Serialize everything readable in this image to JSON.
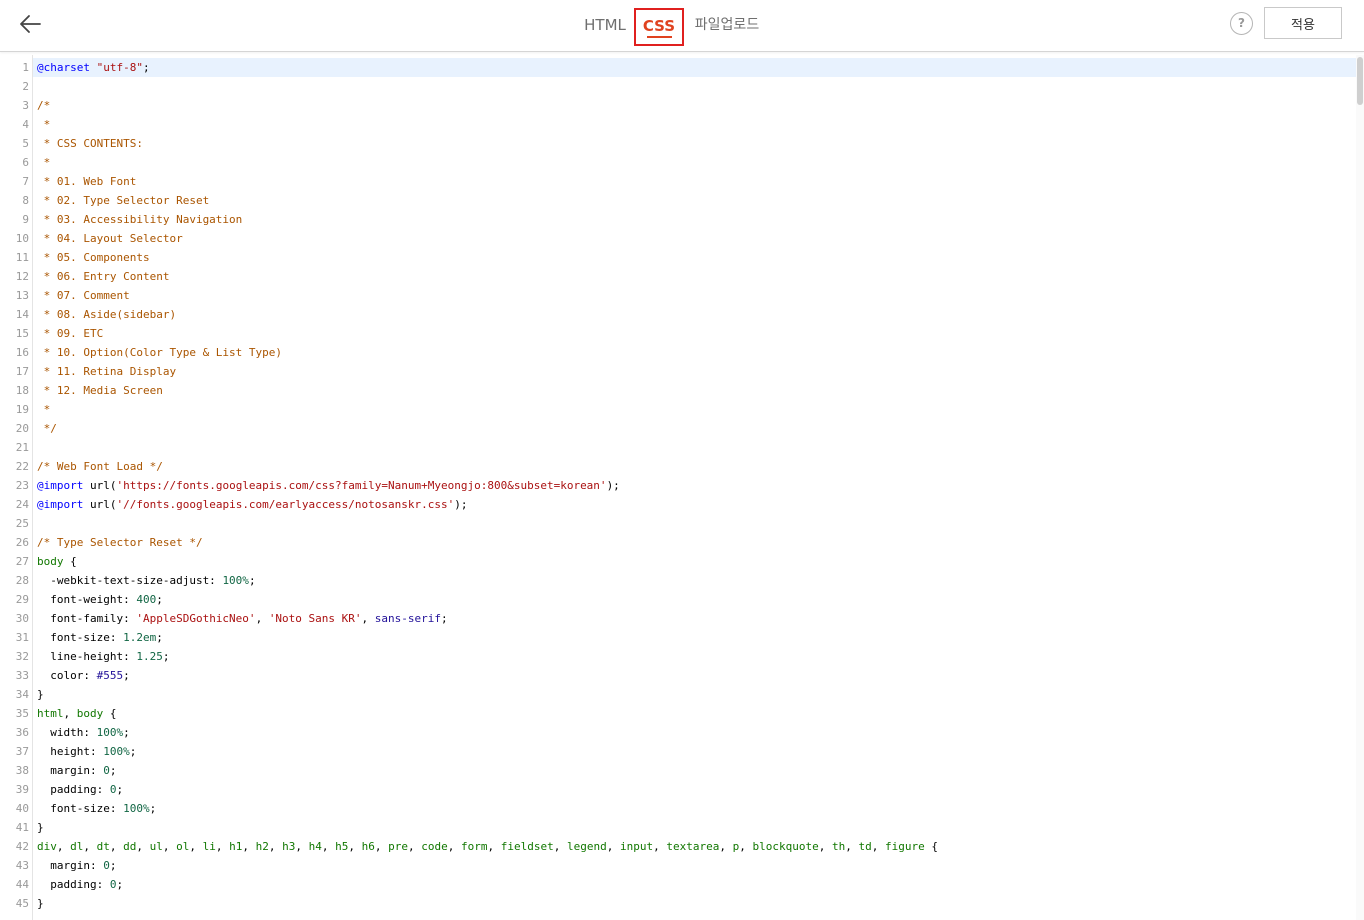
{
  "header": {
    "back_label": "back",
    "tabs": [
      {
        "label": "HTML",
        "active": false
      },
      {
        "label": "CSS",
        "active": true
      },
      {
        "label": "파일업로드",
        "active": false
      }
    ],
    "help_label": "?",
    "apply_label": "적용"
  },
  "editor": {
    "lines": [
      {
        "n": "1",
        "t": [
          [
            "c-def",
            "@charset"
          ],
          [
            "c-plain",
            " "
          ],
          [
            "c-string",
            "\"utf-8\""
          ],
          [
            "c-plain",
            ";"
          ]
        ]
      },
      {
        "n": "2",
        "t": []
      },
      {
        "n": "3",
        "t": [
          [
            "c-comment",
            "/*"
          ]
        ]
      },
      {
        "n": "4",
        "t": [
          [
            "c-comment",
            " *"
          ]
        ]
      },
      {
        "n": "5",
        "t": [
          [
            "c-comment",
            " * CSS CONTENTS:"
          ]
        ]
      },
      {
        "n": "6",
        "t": [
          [
            "c-comment",
            " *"
          ]
        ]
      },
      {
        "n": "7",
        "t": [
          [
            "c-comment",
            " * 01. Web Font"
          ]
        ]
      },
      {
        "n": "8",
        "t": [
          [
            "c-comment",
            " * 02. Type Selector Reset"
          ]
        ]
      },
      {
        "n": "9",
        "t": [
          [
            "c-comment",
            " * 03. Accessibility Navigation"
          ]
        ]
      },
      {
        "n": "10",
        "t": [
          [
            "c-comment",
            " * 04. Layout Selector"
          ]
        ]
      },
      {
        "n": "11",
        "t": [
          [
            "c-comment",
            " * 05. Components"
          ]
        ]
      },
      {
        "n": "12",
        "t": [
          [
            "c-comment",
            " * 06. Entry Content"
          ]
        ]
      },
      {
        "n": "13",
        "t": [
          [
            "c-comment",
            " * 07. Comment"
          ]
        ]
      },
      {
        "n": "14",
        "t": [
          [
            "c-comment",
            " * 08. Aside(sidebar)"
          ]
        ]
      },
      {
        "n": "15",
        "t": [
          [
            "c-comment",
            " * 09. ETC"
          ]
        ]
      },
      {
        "n": "16",
        "t": [
          [
            "c-comment",
            " * 10. Option(Color Type & List Type)"
          ]
        ]
      },
      {
        "n": "17",
        "t": [
          [
            "c-comment",
            " * 11. Retina Display"
          ]
        ]
      },
      {
        "n": "18",
        "t": [
          [
            "c-comment",
            " * 12. Media Screen"
          ]
        ]
      },
      {
        "n": "19",
        "t": [
          [
            "c-comment",
            " *"
          ]
        ]
      },
      {
        "n": "20",
        "t": [
          [
            "c-comment",
            " */"
          ]
        ]
      },
      {
        "n": "21",
        "t": []
      },
      {
        "n": "22",
        "t": [
          [
            "c-comment",
            "/* Web Font Load */"
          ]
        ]
      },
      {
        "n": "23",
        "t": [
          [
            "c-def",
            "@import"
          ],
          [
            "c-plain",
            " url("
          ],
          [
            "c-string",
            "'https://fonts.googleapis.com/css?family=Nanum+Myeongjo:800&subset=korean'"
          ],
          [
            "c-plain",
            ");"
          ]
        ]
      },
      {
        "n": "24",
        "t": [
          [
            "c-def",
            "@import"
          ],
          [
            "c-plain",
            " url("
          ],
          [
            "c-string",
            "'//fonts.googleapis.com/earlyaccess/notosanskr.css'"
          ],
          [
            "c-plain",
            ");"
          ]
        ]
      },
      {
        "n": "25",
        "t": []
      },
      {
        "n": "26",
        "t": [
          [
            "c-comment",
            "/* Type Selector Reset */"
          ]
        ]
      },
      {
        "n": "27",
        "t": [
          [
            "c-tag",
            "body"
          ],
          [
            "c-plain",
            " {"
          ]
        ]
      },
      {
        "n": "28",
        "t": [
          [
            "c-plain",
            "  -webkit-text-size-adjust: "
          ],
          [
            "c-num",
            "100%"
          ],
          [
            "c-plain",
            ";"
          ]
        ]
      },
      {
        "n": "29",
        "t": [
          [
            "c-plain",
            "  font-weight: "
          ],
          [
            "c-num",
            "400"
          ],
          [
            "c-plain",
            ";"
          ]
        ]
      },
      {
        "n": "30",
        "t": [
          [
            "c-plain",
            "  font-family: "
          ],
          [
            "c-string",
            "'AppleSDGothicNeo'"
          ],
          [
            "c-plain",
            ", "
          ],
          [
            "c-string",
            "'Noto Sans KR'"
          ],
          [
            "c-plain",
            ", "
          ],
          [
            "c-atom",
            "sans-serif"
          ],
          [
            "c-plain",
            ";"
          ]
        ]
      },
      {
        "n": "31",
        "t": [
          [
            "c-plain",
            "  font-size: "
          ],
          [
            "c-num",
            "1.2em"
          ],
          [
            "c-plain",
            ";"
          ]
        ]
      },
      {
        "n": "32",
        "t": [
          [
            "c-plain",
            "  line-height: "
          ],
          [
            "c-num",
            "1.25"
          ],
          [
            "c-plain",
            ";"
          ]
        ]
      },
      {
        "n": "33",
        "t": [
          [
            "c-plain",
            "  color: "
          ],
          [
            "c-atom",
            "#555"
          ],
          [
            "c-plain",
            ";"
          ]
        ]
      },
      {
        "n": "34",
        "t": [
          [
            "c-plain",
            "}"
          ]
        ]
      },
      {
        "n": "35",
        "t": [
          [
            "c-tag",
            "html"
          ],
          [
            "c-plain",
            ", "
          ],
          [
            "c-tag",
            "body"
          ],
          [
            "c-plain",
            " {"
          ]
        ]
      },
      {
        "n": "36",
        "t": [
          [
            "c-plain",
            "  width: "
          ],
          [
            "c-num",
            "100%"
          ],
          [
            "c-plain",
            ";"
          ]
        ]
      },
      {
        "n": "37",
        "t": [
          [
            "c-plain",
            "  height: "
          ],
          [
            "c-num",
            "100%"
          ],
          [
            "c-plain",
            ";"
          ]
        ]
      },
      {
        "n": "38",
        "t": [
          [
            "c-plain",
            "  margin: "
          ],
          [
            "c-num",
            "0"
          ],
          [
            "c-plain",
            ";"
          ]
        ]
      },
      {
        "n": "39",
        "t": [
          [
            "c-plain",
            "  padding: "
          ],
          [
            "c-num",
            "0"
          ],
          [
            "c-plain",
            ";"
          ]
        ]
      },
      {
        "n": "40",
        "t": [
          [
            "c-plain",
            "  font-size: "
          ],
          [
            "c-num",
            "100%"
          ],
          [
            "c-plain",
            ";"
          ]
        ]
      },
      {
        "n": "41",
        "t": [
          [
            "c-plain",
            "}"
          ]
        ]
      },
      {
        "n": "42",
        "t": [
          [
            "c-tag",
            "div"
          ],
          [
            "c-plain",
            ", "
          ],
          [
            "c-tag",
            "dl"
          ],
          [
            "c-plain",
            ", "
          ],
          [
            "c-tag",
            "dt"
          ],
          [
            "c-plain",
            ", "
          ],
          [
            "c-tag",
            "dd"
          ],
          [
            "c-plain",
            ", "
          ],
          [
            "c-tag",
            "ul"
          ],
          [
            "c-plain",
            ", "
          ],
          [
            "c-tag",
            "ol"
          ],
          [
            "c-plain",
            ", "
          ],
          [
            "c-tag",
            "li"
          ],
          [
            "c-plain",
            ", "
          ],
          [
            "c-tag",
            "h1"
          ],
          [
            "c-plain",
            ", "
          ],
          [
            "c-tag",
            "h2"
          ],
          [
            "c-plain",
            ", "
          ],
          [
            "c-tag",
            "h3"
          ],
          [
            "c-plain",
            ", "
          ],
          [
            "c-tag",
            "h4"
          ],
          [
            "c-plain",
            ", "
          ],
          [
            "c-tag",
            "h5"
          ],
          [
            "c-plain",
            ", "
          ],
          [
            "c-tag",
            "h6"
          ],
          [
            "c-plain",
            ", "
          ],
          [
            "c-tag",
            "pre"
          ],
          [
            "c-plain",
            ", "
          ],
          [
            "c-tag",
            "code"
          ],
          [
            "c-plain",
            ", "
          ],
          [
            "c-tag",
            "form"
          ],
          [
            "c-plain",
            ", "
          ],
          [
            "c-tag",
            "fieldset"
          ],
          [
            "c-plain",
            ", "
          ],
          [
            "c-tag",
            "legend"
          ],
          [
            "c-plain",
            ", "
          ],
          [
            "c-tag",
            "input"
          ],
          [
            "c-plain",
            ", "
          ],
          [
            "c-tag",
            "textarea"
          ],
          [
            "c-plain",
            ", "
          ],
          [
            "c-tag",
            "p"
          ],
          [
            "c-plain",
            ", "
          ],
          [
            "c-tag",
            "blockquote"
          ],
          [
            "c-plain",
            ", "
          ],
          [
            "c-tag",
            "th"
          ],
          [
            "c-plain",
            ", "
          ],
          [
            "c-tag",
            "td"
          ],
          [
            "c-plain",
            ", "
          ],
          [
            "c-tag",
            "figure"
          ],
          [
            "c-plain",
            " {"
          ]
        ]
      },
      {
        "n": "43",
        "t": [
          [
            "c-plain",
            "  margin: "
          ],
          [
            "c-num",
            "0"
          ],
          [
            "c-plain",
            ";"
          ]
        ]
      },
      {
        "n": "44",
        "t": [
          [
            "c-plain",
            "  padding: "
          ],
          [
            "c-num",
            "0"
          ],
          [
            "c-plain",
            ";"
          ]
        ]
      },
      {
        "n": "45",
        "t": [
          [
            "c-plain",
            "}"
          ]
        ]
      }
    ]
  }
}
